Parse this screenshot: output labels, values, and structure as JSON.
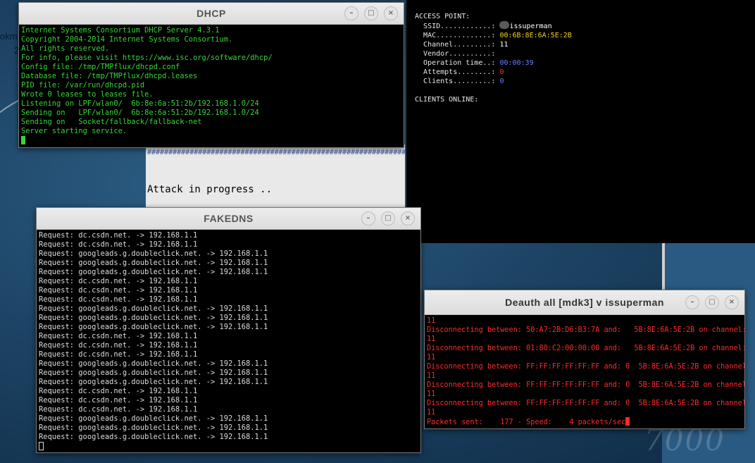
{
  "desktop": {
    "left_text_1": "okm",
    "left_text_2": "2",
    "watermark": "7000"
  },
  "dhcp": {
    "title": "DHCP",
    "lines": [
      "Internet Systems Consortium DHCP Server 4.3.1",
      "Copyright 2004-2014 Internet Systems Consortium.",
      "All rights reserved.",
      "For info, please visit https://www.isc.org/software/dhcp/",
      "Config file: /tmp/TMPflux/dhcpd.conf",
      "Database file: /tmp/TMPflux/dhcpd.leases",
      "PID file: /var/run/dhcpd.pid",
      "Wrote 0 leases to leases file.",
      "Listening on LPF/wlan0/  6b:8e:6a:51:2b/192.168.1.0/24",
      "Sending on   LPF/wlan0/  6b:8e:6a:51:2b/192.168.1.0/24",
      "Sending on   Socket/fallback/fallback-net",
      "Server starting service."
    ]
  },
  "attack": {
    "hashes": "##################################################################",
    "message": "Attack in progress .."
  },
  "access_point": {
    "header": "ACCESS POINT:",
    "ssid_label": "SSID............:",
    "ssid_value": "issuperman",
    "mac_label": "MAC.............:",
    "mac_value": "00:6B:8E:6A:5E:2B",
    "channel_label": "Channel.........:",
    "channel_value": "11",
    "vendor_label": "Vendor..........:",
    "vendor_value": "",
    "optime_label": "Operation time..:",
    "optime_value": "00:00:39",
    "attempts_label": "Attempts........:",
    "attempts_value": "0",
    "clients_label": "Clients.........:",
    "clients_value": "0",
    "clients_online": "CLIENTS ONLINE:"
  },
  "fakedns": {
    "title": "FAKEDNS",
    "lines": [
      "Request: dc.csdn.net. -> 192.168.1.1",
      "Request: dc.csdn.net. -> 192.168.1.1",
      "Request: googleads.g.doubleclick.net. -> 192.168.1.1",
      "Request: googleads.g.doubleclick.net. -> 192.168.1.1",
      "Request: googleads.g.doubleclick.net. -> 192.168.1.1",
      "Request: dc.csdn.net. -> 192.168.1.1",
      "Request: dc.csdn.net. -> 192.168.1.1",
      "Request: dc.csdn.net. -> 192.168.1.1",
      "Request: googleads.g.doubleclick.net. -> 192.168.1.1",
      "Request: googleads.g.doubleclick.net. -> 192.168.1.1",
      "Request: googleads.g.doubleclick.net. -> 192.168.1.1",
      "Request: dc.csdn.net. -> 192.168.1.1",
      "Request: dc.csdn.net. -> 192.168.1.1",
      "Request: dc.csdn.net. -> 192.168.1.1",
      "Request: googleads.g.doubleclick.net. -> 192.168.1.1",
      "Request: googleads.g.doubleclick.net. -> 192.168.1.1",
      "Request: googleads.g.doubleclick.net. -> 192.168.1.1",
      "Request: dc.csdn.net. -> 192.168.1.1",
      "Request: dc.csdn.net. -> 192.168.1.1",
      "Request: dc.csdn.net. -> 192.168.1.1",
      "Request: googleads.g.doubleclick.net. -> 192.168.1.1",
      "Request: googleads.g.doubleclick.net. -> 192.168.1.1",
      "Request: googleads.g.doubleclick.net. -> 192.168.1.1"
    ]
  },
  "mdk3": {
    "title": "Deauth all [mdk3]  v  issuperman",
    "lines": [
      "11",
      "Disconnecting between: 50:A7:2B:D6:B3:7A and:   5B:8E:6A:5E:2B on channel:",
      "11",
      "Disconnecting between: 01:80:C2:00:00:00 and:   5B:8E:6A:5E:2B on channel:",
      "11",
      "Disconnecting between: FF:FF:FF:FF:FF:FF and: 0  5B:8E:6A:5E:2B on channel:",
      "11",
      "Disconnecting between: FF:FF:FF:FF:FF:FF and: 0  5B:8E:6A:5E:2B on channel:",
      "11",
      "Disconnecting between: FF:FF:FF:FF:FF:FF and: 0  5B:8E:6A:5E:2B on channel:",
      "11",
      "Packets sent:    177 - Speed:    4 packets/sec"
    ]
  },
  "window_controls": {
    "minimize": "–",
    "maximize": "□",
    "close": "×"
  }
}
